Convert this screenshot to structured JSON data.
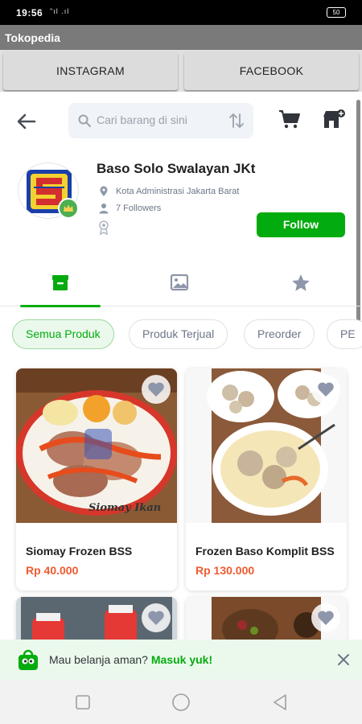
{
  "status_bar": {
    "time": "19:56",
    "signal": "\"ıl .ıl",
    "battery": "50"
  },
  "app": {
    "title": "Tokopedia"
  },
  "social": {
    "instagram_label": "INSTAGRAM",
    "facebook_label": "FACEBOOK"
  },
  "header": {
    "search_placeholder": "Cari barang di sini"
  },
  "shop": {
    "name": "Baso Solo Swalayan JKt",
    "location": "Kota Administrasi Jakarta Barat",
    "followers": "7 Followers",
    "follow_label": "Follow"
  },
  "chips": [
    "Semua Produk",
    "Produk Terjual",
    "Preorder",
    "PE"
  ],
  "products": [
    {
      "name": "Siomay Frozen BSS",
      "price": "Rp 40.000",
      "image_caption": "Siomay Ikan"
    },
    {
      "name": "Frozen Baso Komplit BSS",
      "price": "Rp 130.000"
    },
    {
      "name": "",
      "price": ""
    },
    {
      "name": "",
      "price": ""
    }
  ],
  "banner": {
    "text": "Mau belanja aman? ",
    "link": "Masuk yuk!"
  },
  "colors": {
    "brand_green": "#03ac0e",
    "price_orange": "#ef5a2f",
    "status_black": "#000000",
    "appbar_gray": "#7a7a7a"
  }
}
